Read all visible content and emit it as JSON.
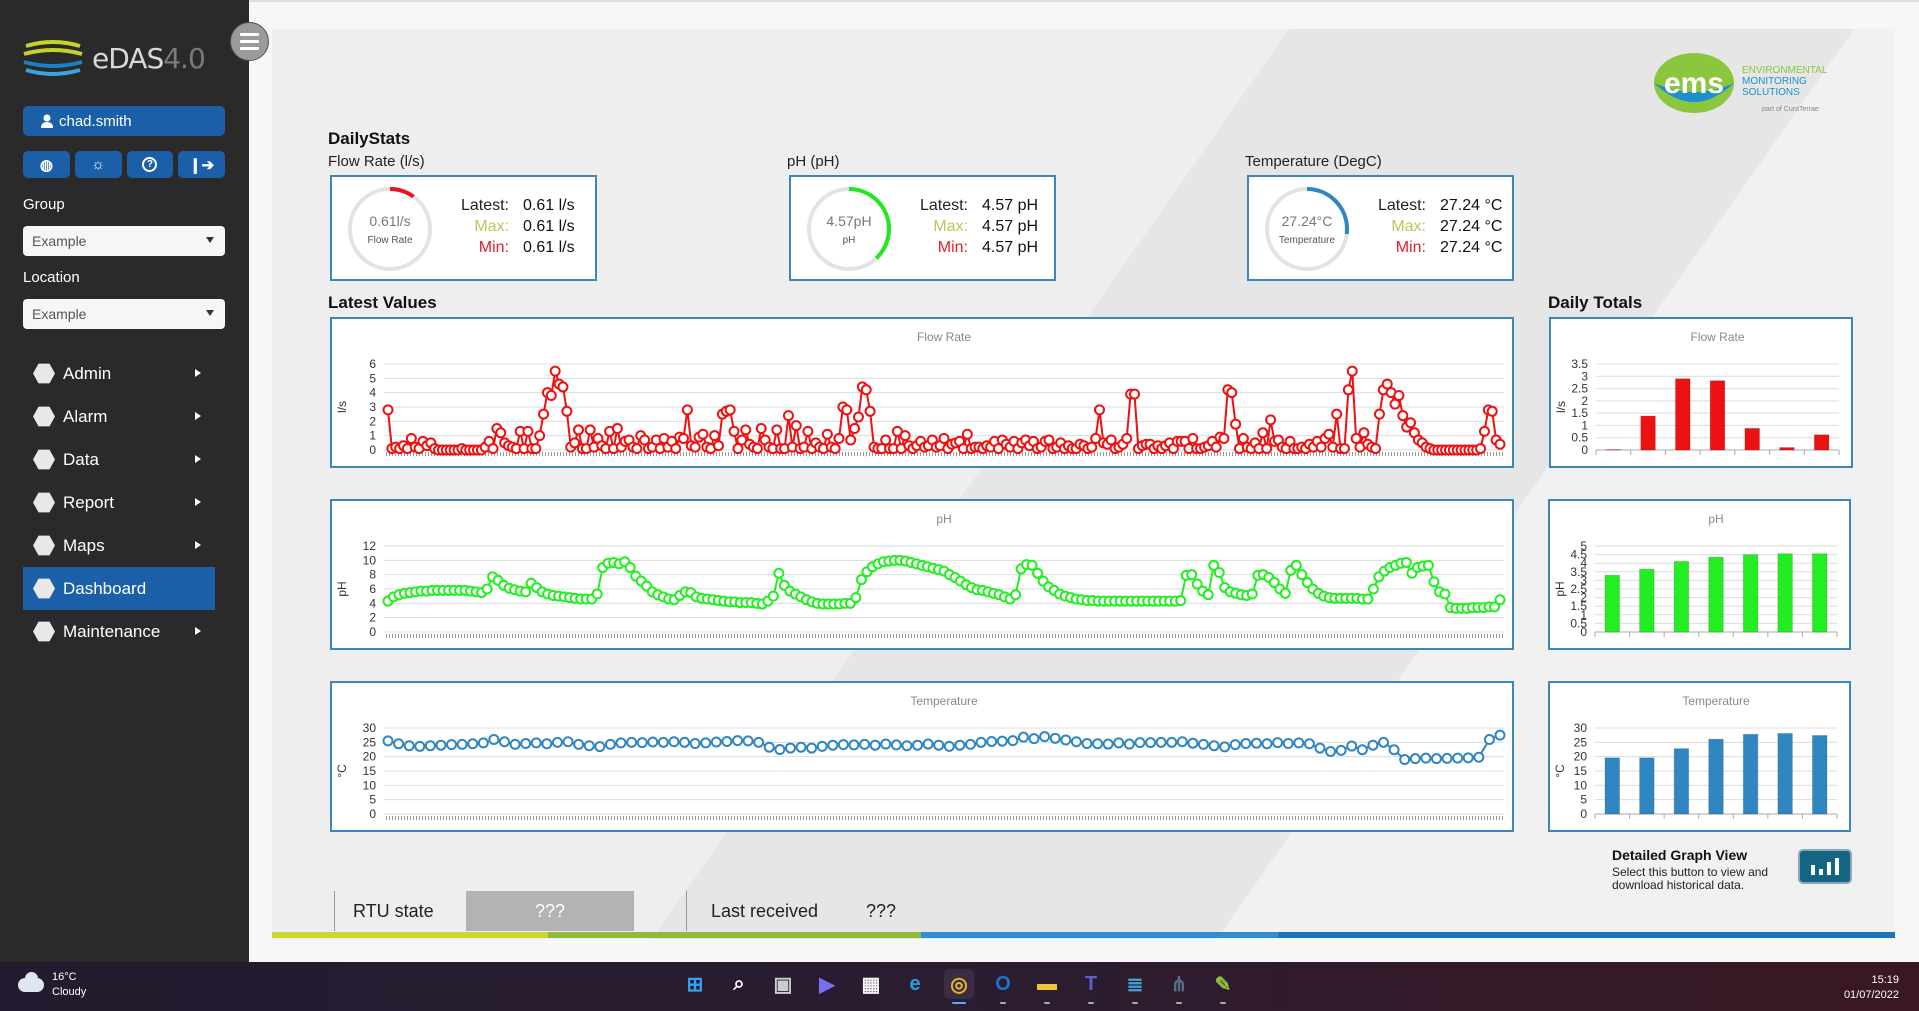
{
  "sidebar": {
    "app_name": "eDAS",
    "app_version": "4.0",
    "user": "chad.smith",
    "icon_buttons": [
      {
        "icon": "globe-icon",
        "glyph": "🌐"
      },
      {
        "icon": "brightness-icon",
        "glyph": "☼"
      },
      {
        "icon": "help-icon",
        "glyph": "?"
      },
      {
        "icon": "logout-icon",
        "glyph": "⇥"
      }
    ],
    "group_label": "Group",
    "group_value": "Example",
    "location_label": "Location",
    "location_value": "Example",
    "nav": [
      {
        "label": "Admin",
        "icon": "admin-icon",
        "glyph": "☺",
        "has_submenu": true,
        "active": false
      },
      {
        "label": "Alarm",
        "icon": "bell-icon",
        "glyph": "♫",
        "has_submenu": true,
        "active": false
      },
      {
        "label": "Data",
        "icon": "gauge-icon",
        "glyph": "◠",
        "has_submenu": true,
        "active": false
      },
      {
        "label": "Report",
        "icon": "document-icon",
        "glyph": "≡",
        "has_submenu": true,
        "active": false
      },
      {
        "label": "Maps",
        "icon": "map-pin-icon",
        "glyph": "◉",
        "has_submenu": true,
        "active": false
      },
      {
        "label": "Dashboard",
        "icon": "dashboard-icon",
        "glyph": "⋰",
        "has_submenu": false,
        "active": true
      },
      {
        "label": "Maintenance",
        "icon": "tools-icon",
        "glyph": "✕",
        "has_submenu": true,
        "active": false
      }
    ]
  },
  "brand": {
    "logo_text": "ems",
    "line1": "ENVIRONMENTAL",
    "line2": "MONITORING",
    "line3": "SOLUTIONS",
    "tagline": "part of CuraTerrae"
  },
  "daily_stats": {
    "title": "DailyStats",
    "cards": [
      {
        "label": "Flow Rate (l/s)",
        "gauge_value": "0.61l/s",
        "gauge_sub": "Flow Rate",
        "gauge_fraction": 0.1,
        "color": "#e8141e",
        "latest_label": "Latest:",
        "latest": "0.61 l/s",
        "max_label": "Max:",
        "max": "0.61 l/s",
        "min_label": "Min:",
        "min": "0.61 l/s"
      },
      {
        "label": "pH (pH)",
        "gauge_value": "4.57pH",
        "gauge_sub": "pH",
        "gauge_fraction": 0.38,
        "color": "#1ee81e",
        "latest_label": "Latest:",
        "latest": "4.57 pH",
        "max_label": "Max:",
        "max": "4.57 pH",
        "min_label": "Min:",
        "min": "4.57 pH"
      },
      {
        "label": "Temperature (DegC)",
        "gauge_value": "27.24°C",
        "gauge_sub": "Temperature",
        "gauge_fraction": 0.27,
        "color": "#2f86c0",
        "latest_label": "Latest:",
        "latest": "27.24 °C",
        "max_label": "Max:",
        "max": "27.24 °C",
        "min_label": "Min:",
        "min": "27.24 °C"
      }
    ]
  },
  "latest_values_title": "Latest Values",
  "daily_totals_title": "Daily Totals",
  "chart_data": [
    {
      "id": "flow-latest",
      "type": "line",
      "title": "Flow Rate",
      "ylabel": "l/s",
      "xlabel": "",
      "ylim": [
        0,
        6
      ],
      "yticks": [
        0,
        1,
        2,
        3,
        4,
        5,
        6
      ],
      "color": "#ee1111",
      "marker": "open-circle",
      "grid": true,
      "values": [
        2.8,
        0.1,
        0.2,
        0.1,
        0.3,
        0.1,
        0.8,
        0.2,
        0.1,
        0.6,
        0.3,
        0.5,
        0.1,
        0.0,
        0.0,
        0.0,
        0.0,
        0.0,
        0.0,
        0.1,
        0.0,
        0.0,
        0.0,
        0.0,
        0.0,
        0.2,
        0.6,
        0.1,
        1.5,
        1.2,
        0.5,
        0.3,
        0.2,
        0.1,
        1.3,
        0.1,
        1.3,
        0.1,
        0.1,
        1.0,
        2.5,
        4.0,
        3.8,
        5.5,
        4.6,
        4.4,
        2.7,
        0.2,
        0.5,
        1.4,
        0.1,
        0.1,
        1.4,
        0.2,
        0.8,
        0.3,
        0.1,
        1.3,
        0.1,
        1.5,
        0.2,
        0.6,
        0.7,
        0.2,
        0.1,
        1.0,
        0.7,
        0.1,
        0.2,
        0.7,
        0.1,
        0.8,
        0.2,
        0.6,
        0.1,
        0.9,
        0.8,
        2.8,
        0.3,
        0.2,
        0.9,
        1.1,
        0.2,
        0.1,
        1.0,
        0.3,
        2.5,
        2.7,
        2.8,
        1.3,
        0.1,
        0.7,
        1.4,
        0.4,
        0.2,
        0.1,
        1.5,
        0.7,
        0.2,
        0.1,
        1.4,
        0.1,
        0.1,
        2.4,
        0.2,
        1.7,
        0.1,
        0.2,
        1.3,
        0.1,
        0.5,
        0.2,
        0.1,
        1.1,
        0.2,
        0.1,
        0.8,
        3.0,
        2.8,
        0.7,
        1.5,
        2.3,
        4.4,
        4.2,
        2.7,
        0.2,
        0.1,
        0.1,
        0.7,
        0.1,
        0.1,
        1.3,
        0.1,
        1.0,
        0.3,
        0.1,
        0.3,
        0.6,
        0.2,
        0.3,
        0.7,
        0.2,
        0.3,
        0.8,
        0.1,
        0.4,
        0.5,
        0.6,
        0.1,
        1.1,
        0.1,
        0.2,
        0.2,
        0.1,
        0.3,
        0.2,
        0.6,
        0.1,
        0.7,
        0.4,
        0.2,
        0.6,
        0.1,
        0.5,
        0.7,
        0.3,
        0.6,
        0.1,
        0.2,
        0.6,
        0.7,
        0.1,
        0.2,
        0.5,
        0.1,
        0.3,
        0.1,
        0.1,
        0.4,
        0.3,
        0.1,
        0.2,
        0.8,
        2.8,
        0.5,
        0.4,
        0.7,
        0.1,
        0.2,
        0.4,
        0.8,
        3.9,
        3.9,
        0.1,
        0.3,
        0.4,
        0.4,
        0.1,
        0.3,
        0.1,
        0.3,
        0.5,
        0.1,
        0.6,
        0.6,
        0.6,
        0.1,
        0.8,
        0.1,
        0.1,
        0.2,
        0.3,
        0.6,
        0.2,
        0.9,
        0.8,
        4.2,
        4.0,
        1.8,
        0.1,
        0.8,
        0.2,
        0.1,
        0.5,
        0.1,
        1.2,
        0.1,
        2.1,
        0.6,
        0.7,
        0.2,
        0.1,
        0.6,
        0.1,
        0.1,
        0.2,
        0.1,
        0.4,
        0.2,
        0.6,
        0.2,
        0.8,
        1.1,
        0.2,
        2.5,
        0.1,
        0.1,
        4.2,
        5.5,
        0.8,
        0.2,
        1.2,
        0.4,
        0.2,
        0.1,
        2.5,
        4.2,
        4.6,
        4.0,
        3.2,
        3.8,
        2.4,
        1.6,
        1.9,
        1.2,
        0.7,
        0.5,
        0.2,
        0.1,
        0.0,
        0.0,
        0.0,
        0.0,
        0.0,
        0.0,
        0.0,
        0.0,
        0.0,
        0.0,
        0.0,
        0.0,
        0.1,
        1.3,
        2.8,
        2.7,
        0.7,
        0.4
      ]
    },
    {
      "id": "ph-latest",
      "type": "line",
      "title": "pH",
      "ylabel": "pH",
      "xlabel": "",
      "ylim": [
        0,
        12
      ],
      "yticks": [
        0,
        2,
        4,
        6,
        8,
        10,
        12
      ],
      "color": "#22ee22",
      "marker": "open-circle",
      "grid": true,
      "values": [
        4.3,
        4.9,
        5.2,
        5.4,
        5.5,
        5.6,
        5.7,
        5.7,
        5.8,
        5.8,
        5.8,
        5.8,
        5.8,
        5.8,
        5.8,
        5.7,
        5.6,
        5.5,
        6.0,
        7.7,
        7.2,
        6.5,
        6.1,
        5.9,
        5.7,
        5.6,
        6.8,
        6.2,
        5.6,
        5.3,
        5.1,
        5.0,
        4.9,
        4.8,
        4.7,
        4.6,
        4.6,
        4.6,
        5.3,
        9.0,
        9.6,
        9.7,
        9.5,
        9.8,
        9.0,
        7.8,
        7.1,
        6.4,
        5.6,
        5.2,
        4.9,
        4.6,
        4.5,
        5.1,
        5.6,
        5.5,
        4.9,
        4.7,
        4.6,
        4.5,
        4.4,
        4.3,
        4.2,
        4.2,
        4.1,
        4.1,
        4.1,
        4.0,
        3.9,
        4.3,
        5.0,
        8.2,
        6.5,
        5.7,
        5.3,
        4.9,
        4.5,
        4.2,
        4.0,
        3.9,
        3.9,
        3.9,
        3.9,
        4.0,
        4.0,
        4.8,
        7.3,
        8.4,
        9.1,
        9.5,
        9.8,
        9.9,
        10.0,
        10.0,
        9.9,
        9.7,
        9.5,
        9.3,
        9.1,
        8.9,
        8.7,
        8.5,
        8.0,
        7.6,
        7.1,
        6.6,
        6.2,
        5.9,
        5.8,
        5.6,
        5.4,
        5.2,
        4.9,
        4.6,
        5.2,
        8.8,
        9.4,
        9.3,
        8.2,
        7.1,
        6.3,
        5.8,
        5.3,
        5.0,
        4.8,
        4.6,
        4.5,
        4.4,
        4.4,
        4.3,
        4.3,
        4.3,
        4.3,
        4.3,
        4.3,
        4.3,
        4.3,
        4.3,
        4.3,
        4.3,
        4.3,
        4.3,
        4.3,
        4.3,
        4.4,
        7.9,
        8.0,
        6.7,
        5.7,
        5.2,
        9.3,
        8.3,
        6.2,
        5.6,
        5.4,
        5.2,
        5.1,
        5.3,
        7.9,
        8.0,
        7.6,
        6.9,
        6.0,
        5.4,
        8.6,
        9.3,
        8.0,
        6.9,
        6.0,
        5.4,
        5.0,
        4.8,
        4.7,
        4.7,
        4.7,
        4.7,
        4.7,
        4.6,
        4.6,
        6.0,
        7.7,
        8.5,
        9.0,
        9.3,
        9.6,
        9.7,
        8.2,
        9.0,
        9.2,
        9.3,
        7.0,
        5.6,
        5.3,
        3.4,
        3.3,
        3.3,
        3.3,
        3.4,
        3.4,
        3.4,
        3.5,
        3.5,
        4.5
      ]
    },
    {
      "id": "temp-latest",
      "type": "line",
      "title": "Temperature",
      "ylabel": "°C",
      "xlabel": "",
      "ylim": [
        0,
        30
      ],
      "yticks": [
        0,
        5,
        10,
        15,
        20,
        25,
        30
      ],
      "color": "#2f86c0",
      "marker": "open-circle",
      "grid": true,
      "values": [
        25.5,
        24.5,
        23.8,
        23.6,
        23.8,
        24.0,
        24.2,
        24.3,
        24.5,
        24.8,
        26.0,
        25.2,
        24.3,
        24.6,
        24.8,
        24.5,
        25.0,
        25.2,
        24.3,
        23.8,
        23.5,
        24.3,
        24.8,
        25.0,
        24.9,
        25.1,
        25.0,
        25.2,
        25.0,
        24.6,
        24.8,
        25.1,
        25.3,
        25.6,
        25.5,
        25.0,
        23.3,
        22.5,
        23.0,
        23.3,
        23.0,
        23.6,
        24.0,
        24.2,
        24.1,
        24.3,
        24.0,
        24.4,
        24.1,
        23.8,
        24.0,
        24.4,
        24.0,
        23.6,
        24.0,
        24.3,
        25.0,
        25.3,
        25.4,
        25.6,
        26.8,
        26.3,
        27.0,
        26.4,
        25.8,
        25.2,
        24.6,
        24.5,
        24.4,
        24.8,
        24.4,
        24.9,
        24.9,
        25.0,
        25.0,
        25.2,
        24.7,
        24.3,
        23.8,
        23.4,
        24.2,
        24.6,
        24.7,
        24.5,
        24.9,
        24.6,
        24.8,
        24.5,
        23.0,
        21.8,
        22.2,
        23.7,
        22.4,
        24.0,
        25.0,
        22.4,
        19.0,
        19.3,
        19.5,
        19.3,
        19.4,
        19.5,
        19.6,
        19.8,
        26.0,
        27.5
      ]
    },
    {
      "id": "flow-daily",
      "type": "bar",
      "title": "Flow Rate",
      "ylabel": "l/s",
      "xlabel": "",
      "ylim": [
        0,
        3.5
      ],
      "yticks": [
        0,
        0.5,
        1,
        1.5,
        2,
        2.5,
        3,
        3.5
      ],
      "color": "#ee1111",
      "grid": true,
      "categories": [
        "",
        "",
        "",
        "",
        "",
        "",
        ""
      ],
      "values": [
        0.02,
        1.38,
        2.9,
        2.82,
        0.88,
        0.1,
        0.62
      ]
    },
    {
      "id": "ph-daily",
      "type": "bar",
      "title": "pH",
      "ylabel": "pH",
      "xlabel": "",
      "ylim": [
        0,
        5
      ],
      "yticks": [
        0,
        0.5,
        1,
        1.5,
        2,
        2.5,
        3,
        3.5,
        4,
        4.5,
        5
      ],
      "color": "#22ee22",
      "grid": true,
      "categories": [
        "",
        "",
        "",
        "",
        "",
        "",
        ""
      ],
      "values": [
        3.3,
        3.65,
        4.1,
        4.35,
        4.5,
        4.55,
        4.55
      ]
    },
    {
      "id": "temp-daily",
      "type": "bar",
      "title": "Temperature",
      "ylabel": "°C",
      "xlabel": "",
      "ylim": [
        0,
        30
      ],
      "yticks": [
        0,
        5,
        10,
        15,
        20,
        25,
        30
      ],
      "color": "#2f86c0",
      "grid": true,
      "categories": [
        "",
        "",
        "",
        "",
        "",
        "",
        ""
      ],
      "values": [
        19.6,
        19.6,
        22.8,
        26.1,
        27.8,
        28.1,
        27.4
      ]
    }
  ],
  "status": {
    "rtu_label": "RTU state",
    "rtu_value": "???",
    "last_received_label": "Last received",
    "last_received_value": "???"
  },
  "detailed_graph": {
    "title": "Detailed Graph View",
    "description": "Select this button to view and download historical data.",
    "icon": "bar-chart-icon"
  },
  "taskbar": {
    "weather_temp": "16°C",
    "weather_desc": "Cloudy",
    "time": "15:19",
    "date": "01/07/2022",
    "apps": [
      {
        "name": "start-icon",
        "glyph": "⊞",
        "color": "#3aa0f0",
        "active": false,
        "running": false
      },
      {
        "name": "search-icon",
        "glyph": "⌕",
        "color": "#ffffff",
        "active": false,
        "running": false
      },
      {
        "name": "task-view-icon",
        "glyph": "▣",
        "color": "#cccccc",
        "active": false,
        "running": false
      },
      {
        "name": "teams-chat-icon",
        "glyph": "▶",
        "color": "#7b6cf0",
        "active": false,
        "running": false
      },
      {
        "name": "store-icon",
        "glyph": "▦",
        "color": "#f4f4f4",
        "active": false,
        "running": false
      },
      {
        "name": "edge-icon",
        "glyph": "e",
        "color": "#1fa3e0",
        "active": false,
        "running": false
      },
      {
        "name": "chrome-icon",
        "glyph": "◎",
        "color": "#e8b62a",
        "active": true,
        "running": true
      },
      {
        "name": "outlook-icon",
        "glyph": "O",
        "color": "#1e72c9",
        "active": false,
        "running": true
      },
      {
        "name": "file-explorer-icon",
        "glyph": "▬",
        "color": "#f3c43b",
        "active": false,
        "running": true
      },
      {
        "name": "teams-icon",
        "glyph": "T",
        "color": "#5b5fc7",
        "active": false,
        "running": true
      },
      {
        "name": "notepad-icon",
        "glyph": "≣",
        "color": "#3fa7d6",
        "active": false,
        "running": true
      },
      {
        "name": "network-app-icon",
        "glyph": "⋔",
        "color": "#5a6b86",
        "active": false,
        "running": true
      },
      {
        "name": "editor-app-icon",
        "glyph": "✎",
        "color": "#8fc43b",
        "active": false,
        "running": true
      }
    ]
  }
}
